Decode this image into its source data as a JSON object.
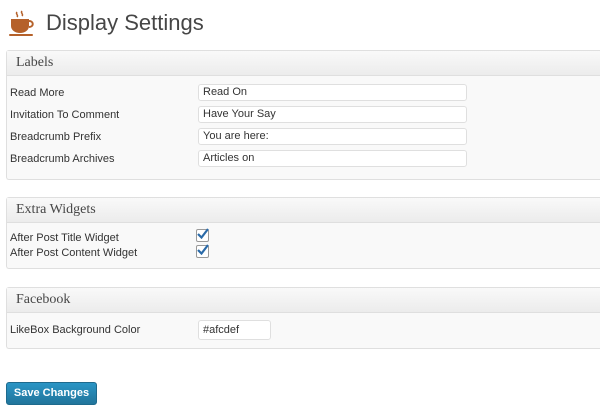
{
  "page": {
    "title": "Display Settings"
  },
  "sections": {
    "labels": {
      "heading": "Labels",
      "fields": [
        {
          "label": "Read More",
          "value": "Read On"
        },
        {
          "label": "Invitation To Comment",
          "value": "Have Your Say"
        },
        {
          "label": "Breadcrumb Prefix",
          "value": "You are here:"
        },
        {
          "label": "Breadcrumb Archives",
          "value": "Articles on"
        }
      ]
    },
    "extra_widgets": {
      "heading": "Extra Widgets",
      "items": [
        {
          "label": "After Post Title Widget",
          "checked": true
        },
        {
          "label": "After Post Content Widget",
          "checked": true
        }
      ]
    },
    "facebook": {
      "heading": "Facebook",
      "fields": [
        {
          "label": "LikeBox Background Color",
          "value": "#afcdef"
        }
      ]
    }
  },
  "actions": {
    "save_label": "Save Changes"
  },
  "colors": {
    "accent": "#21759b",
    "icon": "#b5612a",
    "checkbox": "#2a6aa8"
  },
  "icons": {
    "title": "coffee-cup-icon",
    "checkbox": "checkmark-icon"
  }
}
